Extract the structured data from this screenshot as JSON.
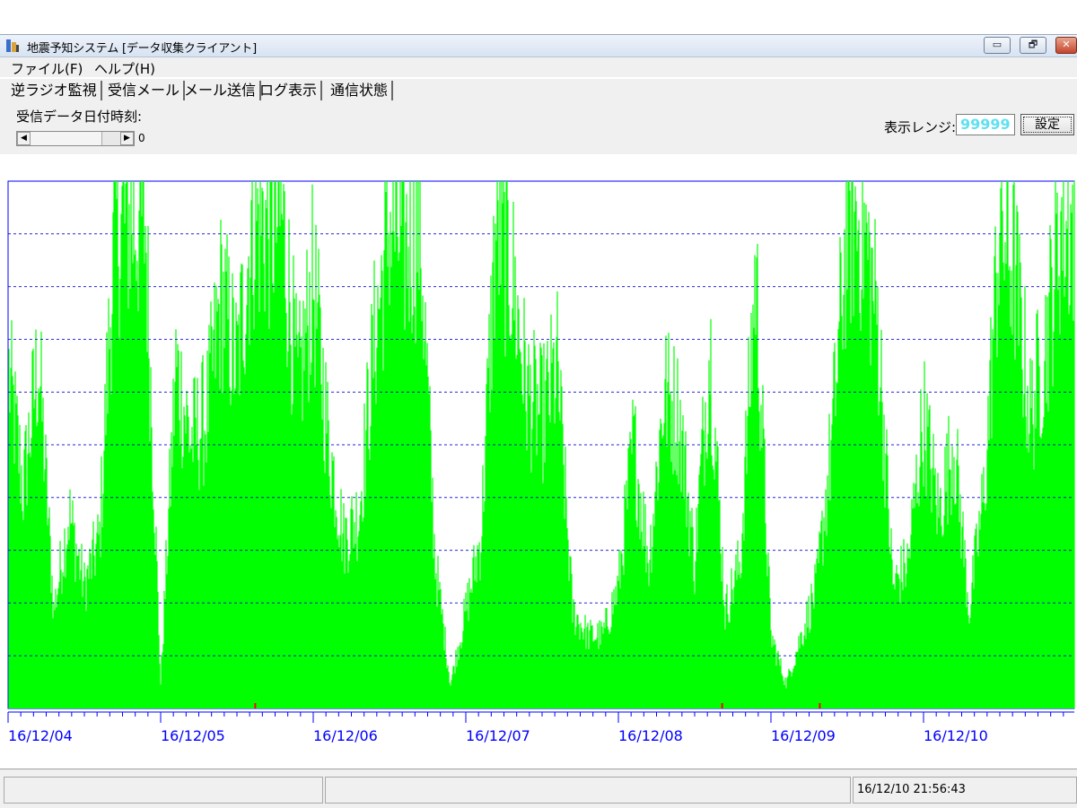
{
  "window": {
    "title": "地震予知システム [データ収集クライアント]",
    "buttons": {
      "minimize": "▭",
      "restore": "🗗",
      "close": "✕"
    }
  },
  "menu": {
    "file": "ファイル(F)",
    "help": "ヘルプ(H)"
  },
  "tabs": [
    "逆ラジオ監視",
    "受信メール",
    "メール送信",
    "ログ表示",
    "通信状態"
  ],
  "controls": {
    "date_label": "受信データ日付時刻:",
    "slider_value": "0",
    "range_label": "表示レンジ:",
    "range_value": "99999",
    "set_button": "設定"
  },
  "status": {
    "datetime": "16/12/10 21:56:43"
  },
  "colors": {
    "signal": "#00ff00",
    "grid": "#0000cc",
    "axis": "#0000ff",
    "range_text": "#5fe0f0",
    "event": "#ff0000"
  },
  "chart_data": {
    "type": "area",
    "x_tick_labels": [
      "16/12/04",
      "16/12/05",
      "16/12/06",
      "16/12/07",
      "16/12/08",
      "16/12/09",
      "16/12/10"
    ],
    "ylim": [
      0,
      99999
    ],
    "grid": "horizontal dashed",
    "series": [
      {
        "envelope_days": [
          4.0,
          4.1,
          4.2,
          4.3,
          4.4,
          4.5,
          4.6,
          4.7,
          4.8,
          4.9,
          5.0,
          5.1,
          5.2,
          5.3,
          5.4,
          5.5,
          5.6,
          5.7,
          5.8,
          5.9,
          6.0,
          6.1,
          6.2,
          6.3,
          6.4,
          6.5,
          6.6,
          6.7,
          6.8,
          6.9,
          7.0,
          7.1,
          7.2,
          7.3,
          7.4,
          7.5,
          7.6,
          7.7,
          7.8,
          7.9,
          8.0,
          8.1,
          8.2,
          8.3,
          8.4,
          8.5,
          8.6,
          8.7,
          8.8,
          8.9,
          9.0,
          9.1,
          9.2,
          9.3,
          9.4,
          9.5,
          9.6,
          9.7,
          9.8,
          9.9,
          10.0,
          10.1,
          10.2,
          10.3,
          10.4,
          10.5,
          10.6,
          10.7,
          10.8,
          10.9,
          10.99
        ],
        "envelope_values": [
          70000,
          45000,
          72000,
          20000,
          40000,
          25000,
          35000,
          99999,
          99999,
          99999,
          5000,
          70000,
          55000,
          60000,
          85000,
          70000,
          99999,
          99999,
          99999,
          65000,
          88000,
          55000,
          35000,
          40000,
          75000,
          99999,
          95000,
          99999,
          30000,
          5000,
          20000,
          35000,
          99999,
          90000,
          65000,
          60000,
          70000,
          20000,
          15000,
          15000,
          25000,
          55000,
          30000,
          65000,
          60000,
          30000,
          75000,
          20000,
          30000,
          90000,
          15000,
          5000,
          15000,
          25000,
          55000,
          99999,
          99999,
          80000,
          25000,
          30000,
          60000,
          40000,
          55000,
          20000,
          45000,
          99999,
          90000,
          60000,
          75000,
          99999,
          99999
        ],
        "red_event_days": [
          5.62,
          8.68,
          9.32
        ]
      }
    ]
  }
}
